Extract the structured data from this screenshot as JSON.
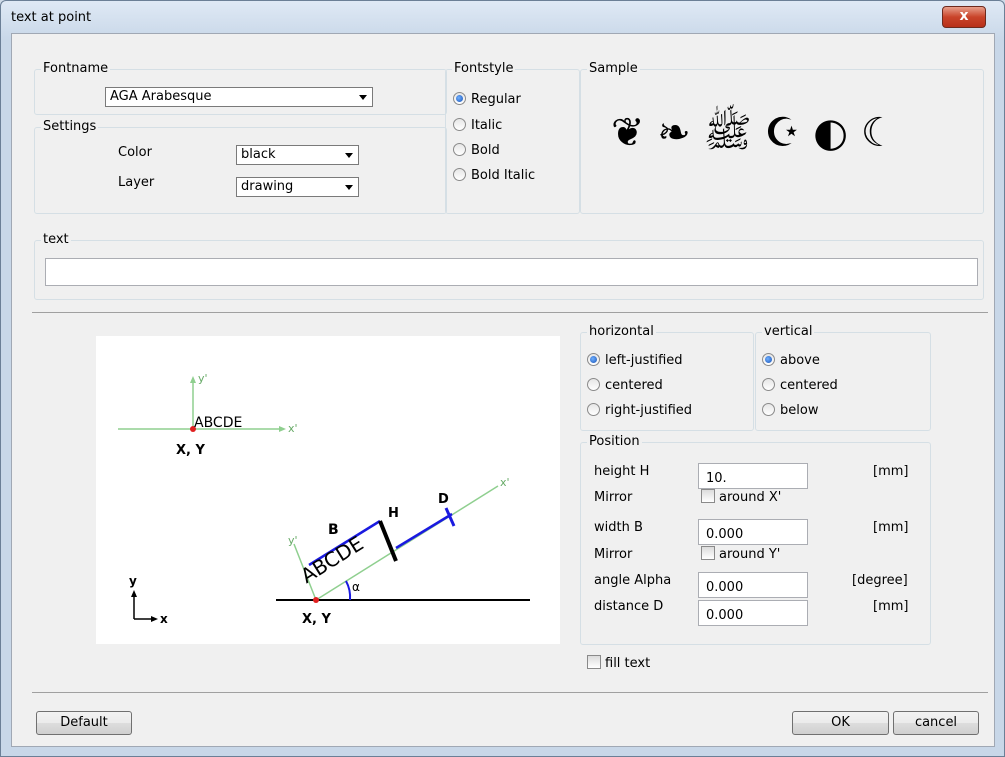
{
  "window": {
    "title": "text at point",
    "close_glyph": "x"
  },
  "fontname": {
    "legend": "Fontname",
    "selected": "AGA Arabesque"
  },
  "settings": {
    "legend": "Settings",
    "color_label": "Color",
    "color_value": "black",
    "layer_label": "Layer",
    "layer_value": "drawing"
  },
  "fontstyle": {
    "legend": "Fontstyle",
    "options": [
      "Regular",
      "Italic",
      "Bold",
      "Bold Italic"
    ],
    "selected": "Regular"
  },
  "sample": {
    "legend": "Sample",
    "preview": "❦ ❧ ﷺ ☪ ◐ ☾"
  },
  "text_group": {
    "legend": "text",
    "value": ""
  },
  "horizontal": {
    "legend": "horizontal",
    "options": [
      "left-justified",
      "centered",
      "right-justified"
    ],
    "selected": "left-justified"
  },
  "vertical": {
    "legend": "vertical",
    "options": [
      "above",
      "centered",
      "below"
    ],
    "selected": "above"
  },
  "position": {
    "legend": "Position",
    "height_label": "height H",
    "height_value": "10.",
    "height_unit": "[mm]",
    "mirror_label_1": "Mirror",
    "mirror_x_label": "around X'",
    "width_label": "width B",
    "width_value": "0.000",
    "width_unit": "[mm]",
    "mirror_label_2": "Mirror",
    "mirror_y_label": "around Y'",
    "angle_label": "angle Alpha",
    "angle_value": "0.000",
    "angle_unit": "[degree]",
    "distance_label": "distance D",
    "distance_value": "0.000",
    "distance_unit": "[mm]"
  },
  "fill_text_label": "fill text",
  "buttons": {
    "default": "Default",
    "ok": "OK",
    "cancel": "cancel"
  },
  "diagram": {
    "top": {
      "text": "ABCDE",
      "xy": "X, Y",
      "y_prime": "y'",
      "x_prime": "x'"
    },
    "bottom": {
      "text": "ABCDE",
      "xy": "X, Y",
      "b": "B",
      "h": "H",
      "d": "D",
      "alpha": "α",
      "y_prime": "y'",
      "x_prime": "x'"
    },
    "axes": {
      "y": "y",
      "x": "x"
    }
  }
}
